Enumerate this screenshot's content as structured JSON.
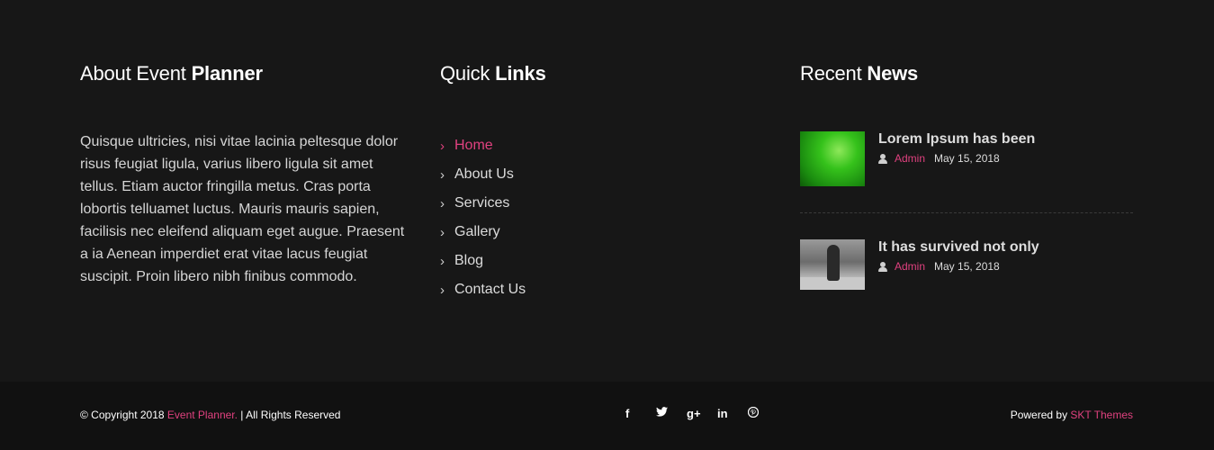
{
  "about": {
    "title_light": "About Event ",
    "title_bold": "Planner",
    "text": "Quisque ultricies, nisi vitae lacinia peltesque dolor risus feugiat ligula, varius libero ligula sit amet tellus. Etiam auctor fringilla metus. Cras porta lobortis telluamet luctus. Mauris mauris sapien, facilisis nec eleifend aliquam eget augue. Praesent a ia Aenean imperdiet erat vitae lacus feugiat suscipit. Proin libero nibh finibus commodo."
  },
  "quick_links": {
    "title_light": "Quick ",
    "title_bold": "Links",
    "chevron": "›",
    "items": [
      {
        "label": "Home"
      },
      {
        "label": "About Us"
      },
      {
        "label": "Services"
      },
      {
        "label": "Gallery"
      },
      {
        "label": "Blog"
      },
      {
        "label": "Contact Us"
      }
    ],
    "active_index": 0
  },
  "recent_news": {
    "title_light": "Recent ",
    "title_bold": "News",
    "items": [
      {
        "title": "Lorem Ipsum has been",
        "author": "Admin",
        "date": "May 15, 2018",
        "thumb": "green-leaf-image"
      },
      {
        "title": "It has survived not only",
        "author": "Admin",
        "date": "May 15, 2018",
        "thumb": "grayscale-person-image"
      }
    ]
  },
  "bottom": {
    "copyright_prefix": "© Copyright 2018 ",
    "copyright_brand": "Event Planner.",
    "copyright_suffix": " | All Rights Reserved",
    "powered_prefix": "Powered by ",
    "powered_brand": "SKT Themes",
    "social": [
      {
        "icon": "facebook-icon",
        "glyph": "f"
      },
      {
        "icon": "twitter-icon",
        "glyph": "🐦"
      },
      {
        "icon": "google-plus-icon",
        "glyph": "g+"
      },
      {
        "icon": "linkedin-icon",
        "glyph": "in"
      },
      {
        "icon": "pinterest-icon",
        "glyph": "℗"
      }
    ]
  },
  "colors": {
    "accent": "#e0417f",
    "background": "#171717",
    "bottom_bar": "#111111"
  }
}
